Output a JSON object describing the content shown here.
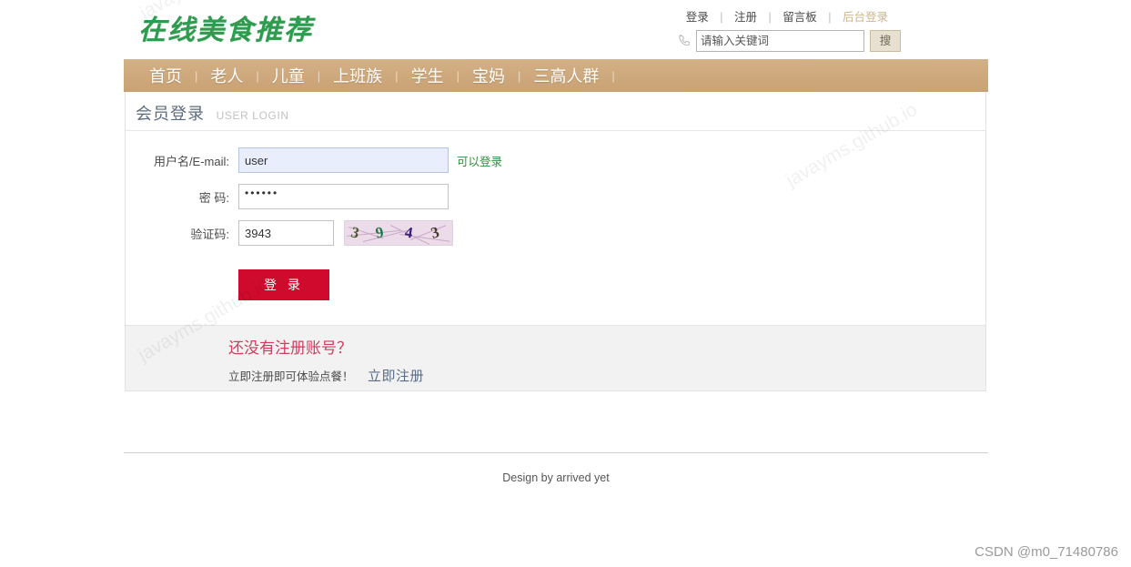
{
  "site": {
    "logo_text": "在线美食推荐"
  },
  "top_links": {
    "login": "登录",
    "register": "注册",
    "guestbook": "留言板",
    "admin": "后台登录",
    "separator": "|"
  },
  "search": {
    "placeholder": "请输入关键词",
    "value": "",
    "button_label": "搜",
    "icon": "phone-icon"
  },
  "nav": {
    "separator": "|",
    "items": [
      {
        "label": "首页"
      },
      {
        "label": "老人"
      },
      {
        "label": "儿童"
      },
      {
        "label": "上班族"
      },
      {
        "label": "学生"
      },
      {
        "label": "宝妈"
      },
      {
        "label": "三高人群"
      }
    ]
  },
  "panel": {
    "title_cn": "会员登录",
    "title_en": "USER LOGIN"
  },
  "form": {
    "username": {
      "label": "用户名/E-mail:",
      "value": "user",
      "placeholder": "",
      "hint": "可以登录"
    },
    "password": {
      "label": "密 码:",
      "value": "••••••",
      "placeholder": ""
    },
    "captcha": {
      "label": "验证码:",
      "value": "3943",
      "placeholder": "",
      "image_digits": [
        "3",
        "9",
        "4",
        "3"
      ]
    },
    "submit_label": "登 录"
  },
  "register": {
    "title": "还没有注册账号？",
    "subtitle": "立即注册即可体验点餐！",
    "link_label": "立即注册"
  },
  "footer": {
    "text": "Design by arrived yet"
  },
  "watermark": {
    "text": "javayms.github.io"
  },
  "attribution": {
    "text": "CSDN @m0_71480786"
  },
  "colors": {
    "nav_bg": "#cfab7d",
    "logo_green": "#2e9b4e",
    "login_button": "#cf0a2c",
    "register_title": "#d13b5e",
    "hint_green": "#2f8f3e",
    "panel_title": "#5c6b7f"
  }
}
